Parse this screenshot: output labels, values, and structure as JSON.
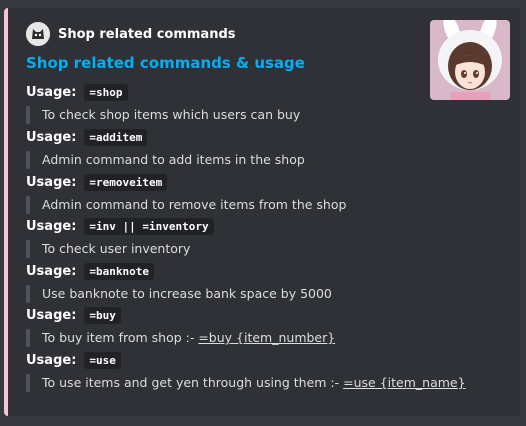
{
  "embed": {
    "accent_color": "#f8c5d3",
    "author": {
      "name": "Shop related commands",
      "icon": "cat-avatar-icon"
    },
    "title": "Shop related commands & usage",
    "thumbnail": "anime-girl-bunny-hood-thumbnail",
    "fields": [
      {
        "label": "Usage:",
        "command": "=shop",
        "text": "To check shop items which users can buy"
      },
      {
        "label": "Usage:",
        "command": "=additem",
        "text": "Admin command to add items in the shop"
      },
      {
        "label": "Usage:",
        "command": "=removeitem",
        "text": "Admin command to remove items from the shop"
      },
      {
        "label": "Usage:",
        "command": "=inv || =inventory",
        "text": "To check user inventory"
      },
      {
        "label": "Usage:",
        "command": "=banknote",
        "text": "Use banknote to increase bank space by 5000"
      },
      {
        "label": "Usage:",
        "command": "=buy",
        "text": "To buy item from shop :- ",
        "link": "=buy {item_number}"
      },
      {
        "label": "Usage:",
        "command": "=use",
        "text": "To use items and get yen through using them :- ",
        "link": "=use {item_name}"
      }
    ]
  }
}
